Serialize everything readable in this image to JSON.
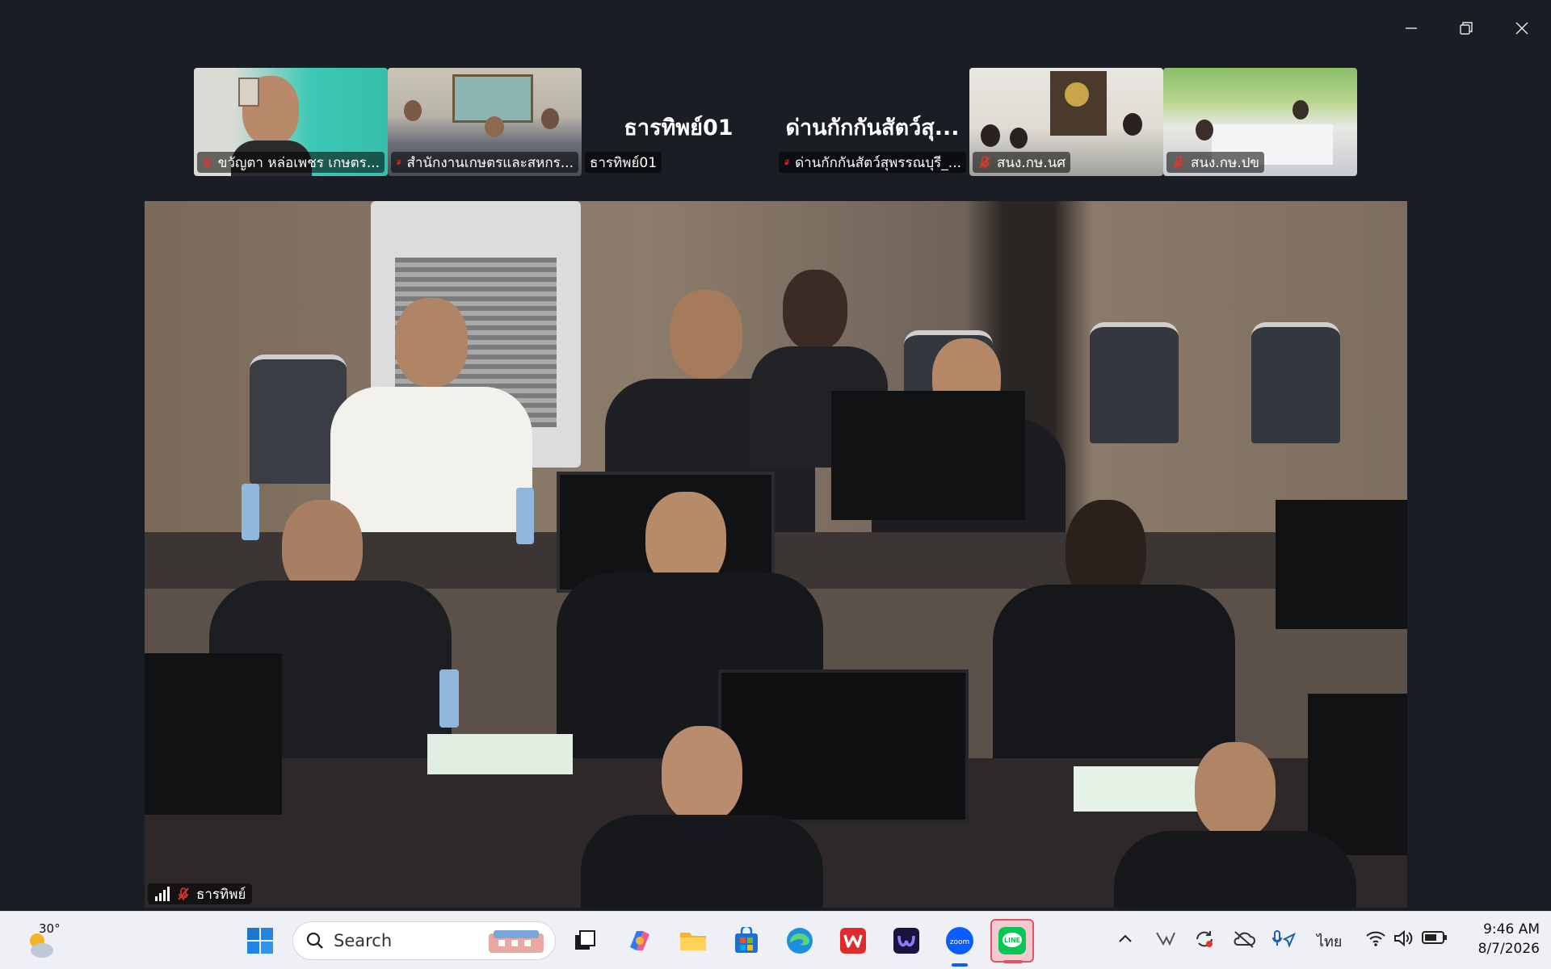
{
  "window": {
    "minimize_icon": "minimize-icon",
    "maximize_icon": "restore-icon",
    "close_icon": "close-icon"
  },
  "thumbnails": [
    {
      "label": "ขวัญตา  หล่อเพชร เกษตร...",
      "muted": true,
      "type": "video"
    },
    {
      "label": "สำนักงานเกษตรและสหกร...",
      "muted": true,
      "type": "video"
    },
    {
      "label": "ธารทิพย์01",
      "big_name": "ธารทิพย์01",
      "muted": false,
      "type": "name"
    },
    {
      "label": "ด่านกักกันสัตว์สุพรรณบุรี_...",
      "big_name": "ด่านกักกันสัตว์สุ...",
      "muted": true,
      "type": "name"
    },
    {
      "label": "สนง.กษ.นศ",
      "muted": true,
      "type": "video"
    },
    {
      "label": "สนง.กษ.ปข",
      "muted": true,
      "type": "video"
    }
  ],
  "main_video": {
    "speaker_label": "ธารทิพย์",
    "muted": true,
    "signal_icon": "signal-bars-icon"
  },
  "taskbar": {
    "weather_temp": "30°",
    "search_placeholder": "Search",
    "apps": [
      "windows-start-icon",
      "search-icon",
      "task-view-icon",
      "copilot-icon",
      "file-explorer-icon",
      "microsoft-store-icon",
      "edge-icon",
      "wps-icon",
      "clipchamp-icon",
      "zoom-icon",
      "line-icon"
    ],
    "language": "ไทย",
    "time": "9:46 AM",
    "date": "8/7/2026"
  },
  "colors": {
    "background": "#1a1d24",
    "taskbar": "#eef0f5",
    "mute_red": "#e0362c",
    "zoom_blue": "#0b5cff",
    "line_green": "#06c755"
  }
}
